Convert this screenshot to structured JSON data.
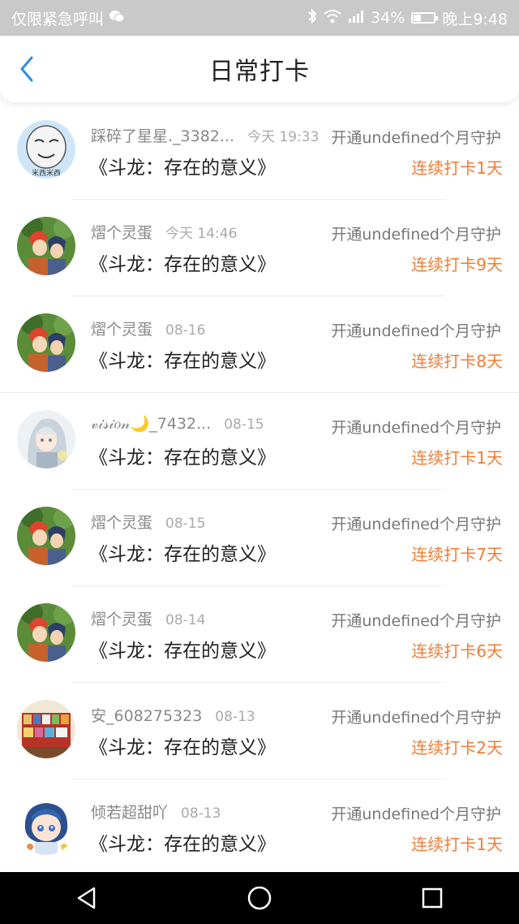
{
  "status_bar": {
    "left_text": "仅限紧急呼叫",
    "battery": "34%",
    "time": "晚上9:48",
    "battery_level": 0.34
  },
  "header": {
    "title": "日常打卡"
  },
  "entries": [
    {
      "username": "踩碎了星星._3382...",
      "time": "今天 19:33",
      "book": "《斗龙：存在的意义》",
      "guard": "开通undefined个月守护",
      "streak": "连续打卡1天",
      "avatar_icon": "meme-face-avatar",
      "avatar_caption": "米西米西"
    },
    {
      "username": "熠个灵蛋",
      "time": "今天 14:46",
      "book": "《斗龙：存在的意义》",
      "guard": "开通undefined个月守护",
      "streak": "连续打卡9天",
      "avatar_icon": "anime-boys-avatar"
    },
    {
      "username": "熠个灵蛋",
      "time": "08-16",
      "book": "《斗龙：存在的意义》",
      "guard": "开通undefined个月守护",
      "streak": "连续打卡8天",
      "avatar_icon": "anime-boys-avatar"
    },
    {
      "username": "𝓋𝒾𝓈𝒾𝑜𝓃🌙_7432...",
      "time": "08-15",
      "book": "《斗龙：存在的意义》",
      "guard": "开通undefined个月守护",
      "streak": "连续打卡1天",
      "avatar_icon": "anime-girl-silver-avatar"
    },
    {
      "username": "熠个灵蛋",
      "time": "08-15",
      "book": "《斗龙：存在的意义》",
      "guard": "开通undefined个月守护",
      "streak": "连续打卡7天",
      "avatar_icon": "anime-boys-avatar"
    },
    {
      "username": "熠个灵蛋",
      "time": "08-14",
      "book": "《斗龙：存在的意义》",
      "guard": "开通undefined个月守护",
      "streak": "连续打卡6天",
      "avatar_icon": "anime-boys-avatar"
    },
    {
      "username": "安_608275323",
      "time": "08-13",
      "book": "《斗龙：存在的意义》",
      "guard": "开通undefined个月守护",
      "streak": "连续打卡2天",
      "avatar_icon": "photo-shelf-avatar"
    },
    {
      "username": "倾若超甜吖",
      "time": "08-13",
      "book": "《斗龙：存在的意义》",
      "guard": "开通undefined个月守护",
      "streak": "连续打卡1天",
      "avatar_icon": "anime-chibi-blue-avatar"
    }
  ],
  "colors": {
    "accent_blue": "#2b8fe6",
    "streak_orange": "#f07d35",
    "status_bar_bg": "#c9c9c9"
  }
}
